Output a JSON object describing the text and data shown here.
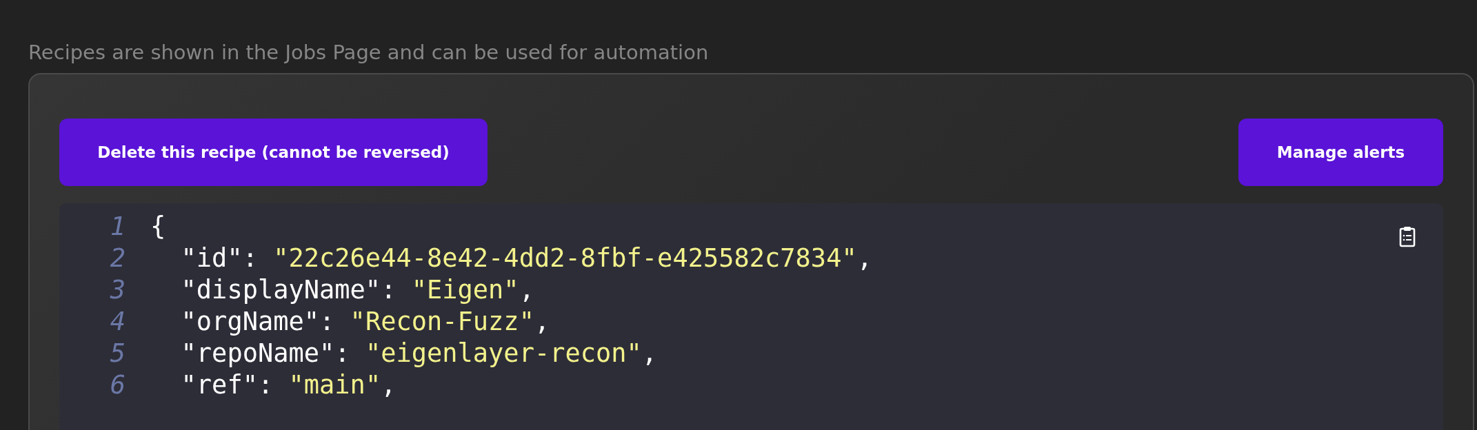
{
  "caption": "Recipes are shown in the Jobs Page and can be used for automation",
  "buttons": [
    {
      "label": "Delete this recipe (cannot be reversed)"
    },
    {
      "label": "Manage alerts"
    }
  ],
  "code": {
    "lines": [
      {
        "number": "1",
        "tokens": [
          {
            "kind": "punct",
            "text": "{"
          }
        ]
      },
      {
        "number": "2",
        "tokens": [
          {
            "kind": "key",
            "text": "  \"id\""
          },
          {
            "kind": "punct",
            "text": ": "
          },
          {
            "kind": "string",
            "text": "\"22c26e44-8e42-4dd2-8fbf-e425582c7834\""
          },
          {
            "kind": "punct",
            "text": ","
          }
        ]
      },
      {
        "number": "3",
        "tokens": [
          {
            "kind": "key",
            "text": "  \"displayName\""
          },
          {
            "kind": "punct",
            "text": ": "
          },
          {
            "kind": "string",
            "text": "\"Eigen\""
          },
          {
            "kind": "punct",
            "text": ","
          }
        ]
      },
      {
        "number": "4",
        "tokens": [
          {
            "kind": "key",
            "text": "  \"orgName\""
          },
          {
            "kind": "punct",
            "text": ": "
          },
          {
            "kind": "string",
            "text": "\"Recon-Fuzz\""
          },
          {
            "kind": "punct",
            "text": ","
          }
        ]
      },
      {
        "number": "5",
        "tokens": [
          {
            "kind": "key",
            "text": "  \"repoName\""
          },
          {
            "kind": "punct",
            "text": ": "
          },
          {
            "kind": "string",
            "text": "\"eigenlayer-recon\""
          },
          {
            "kind": "punct",
            "text": ","
          }
        ]
      },
      {
        "number": "6",
        "tokens": [
          {
            "kind": "key",
            "text": "  \"ref\""
          },
          {
            "kind": "punct",
            "text": ": "
          },
          {
            "kind": "string",
            "text": "\"main\""
          },
          {
            "kind": "punct",
            "text": ","
          }
        ]
      }
    ]
  }
}
